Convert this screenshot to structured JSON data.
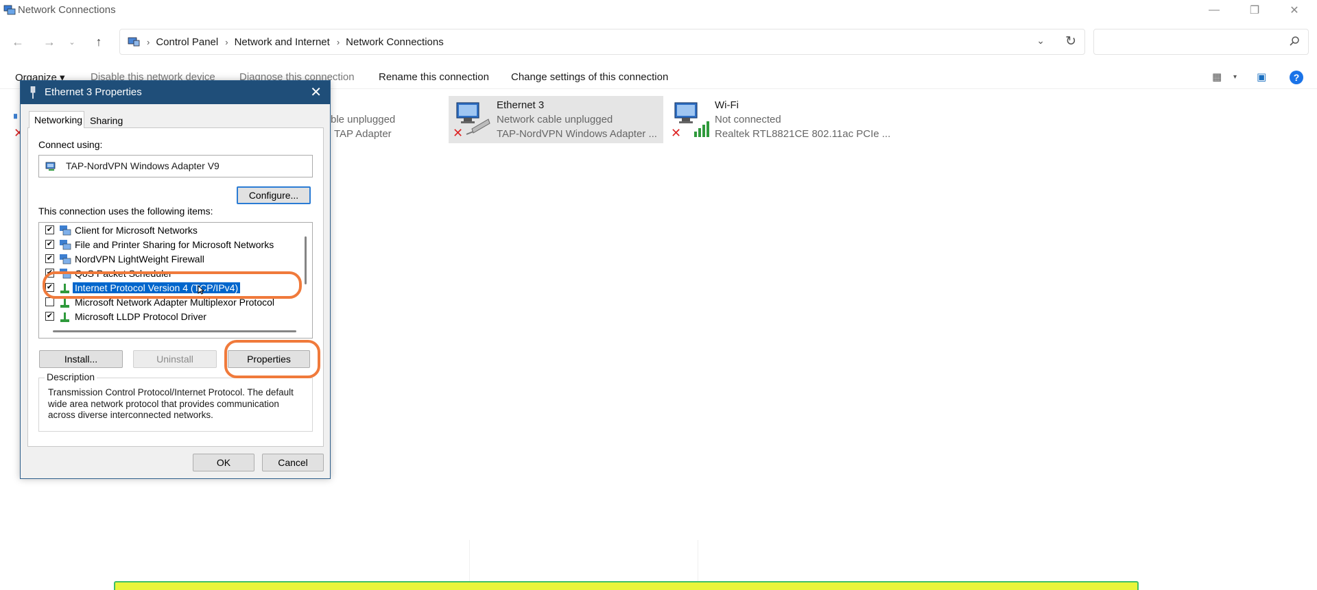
{
  "window": {
    "title": "Network Connections",
    "controls": {
      "minimize": "—",
      "restore": "❐",
      "close": "✕"
    }
  },
  "nav": {
    "back": "←",
    "forward": "→",
    "recent": "⌄",
    "up": "↑"
  },
  "breadcrumb": {
    "items": [
      "Control Panel",
      "Network and Internet",
      "Network Connections"
    ],
    "separator": "›"
  },
  "address_dropdown": "⌄",
  "address_refresh": "↻",
  "search": {
    "placeholder": ""
  },
  "commands": {
    "organize": "Organize ▾",
    "disable": "Disable this network device",
    "diagnose": "Diagnose this connection",
    "rename": "Rename this connection",
    "change": "Change settings of this connection"
  },
  "view_controls": {
    "views": "▦",
    "views_dropdown": "▾",
    "preview_pane": "▣",
    "help": "?"
  },
  "connections": [
    {
      "name": "",
      "status": "ble unplugged",
      "device": "TAP Adapter"
    },
    {
      "name": "Ethernet 3",
      "status": "Network cable unplugged",
      "device": "TAP-NordVPN Windows Adapter ..."
    },
    {
      "name": "Wi-Fi",
      "status": "Not connected",
      "device": "Realtek RTL8821CE 802.11ac PCIe ..."
    }
  ],
  "dialog": {
    "title": "Ethernet 3 Properties",
    "close": "✕",
    "tabs": [
      "Networking",
      "Sharing"
    ],
    "connect_using_label": "Connect using:",
    "adapter": "TAP-NordVPN Windows Adapter V9",
    "configure": "Configure...",
    "items_label": "This connection uses the following items:",
    "items": [
      {
        "label": "Client for Microsoft Networks",
        "checked": "✔"
      },
      {
        "label": "File and Printer Sharing for Microsoft Networks",
        "checked": "✔"
      },
      {
        "label": "NordVPN LightWeight Firewall",
        "checked": "✔"
      },
      {
        "label": "QoS Packet Scheduler",
        "checked": "✔"
      },
      {
        "label": "Internet Protocol Version 4 (TCP/IPv4)",
        "checked": "✔"
      },
      {
        "label": "Microsoft Network Adapter Multiplexor Protocol",
        "checked": ""
      },
      {
        "label": "Microsoft LLDP Protocol Driver",
        "checked": "✔"
      }
    ],
    "install": "Install...",
    "uninstall": "Uninstall",
    "properties": "Properties",
    "description_label": "Description",
    "description": "Transmission Control Protocol/Internet Protocol. The default wide area network protocol that provides communication across diverse interconnected networks.",
    "ok": "OK",
    "cancel": "Cancel"
  },
  "colors": {
    "dialog_title": "#1f4e79",
    "selection": "#0066cc",
    "highlight_annotation": "#f07a3b",
    "banner": "#e9f53b",
    "banner_border": "#3fbf6a",
    "error_x": "#dd2222"
  }
}
